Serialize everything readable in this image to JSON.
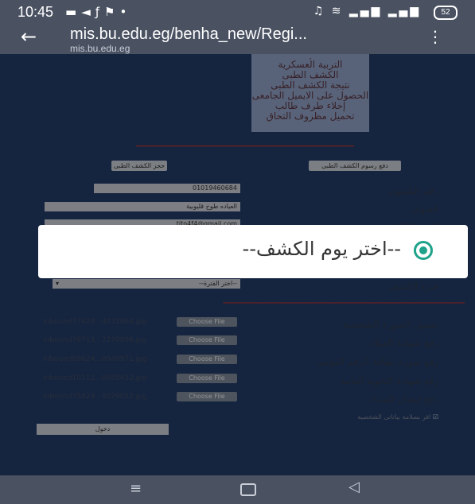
{
  "status_bar": {
    "time": "10:45",
    "left_icons": [
      "message-icon",
      "send-icon",
      "facebook-icon",
      "notification-icon",
      "dot-icon"
    ],
    "battery": "52"
  },
  "browser": {
    "url": "mis.bu.edu.eg/benha_new/Regi...",
    "domain": "mis.bu.edu.eg"
  },
  "menu_box": {
    "items": [
      "التربية العسكرية",
      "الكشف الطبى",
      "نتيجة الكشف الطبى",
      "الحصول على الايميل الجامعى",
      "إخلاء طرف طالب",
      "تحميل مظروف التحاق"
    ]
  },
  "buttons": {
    "pay_medical_fee": "دفع رسوم الكشف الطبى",
    "book_medical": "حجز الكشف الطبى",
    "choose_file": "Choose File",
    "submit": "دخول"
  },
  "form": {
    "phone_label": "رقم التليفون",
    "phone_value": "01019460684",
    "address_label": "العنوان",
    "address_value": "العياده طوخ قليوبية",
    "email_label": "البريد الالكترونى",
    "email_value": "tito4f4@gmail.com",
    "exam_period_label": "فترة الكشف",
    "exam_period_value": "--اختر الفترة--",
    "photo_label": "تحميل الصورة الشخصية",
    "birth_cert_label": "رفع شهادة الميلاد",
    "national_id_label": "رفع صورة بطاقة الرقم القومى",
    "secondary_cert_label": "رفع شهادة الثانوية العامة",
    "payment_label": "رفع إيصال السداد",
    "confirm_label": "اقر بسلامة بياناتى الشخصية",
    "files": [
      "inbound37429...4031464.jpg",
      "inbound76713...2270906.jpg",
      "inbound68624...0949971.jpg",
      "inbound10112...0085432.jpg",
      "inbound35829...9029052.jpg"
    ]
  },
  "dialog": {
    "option_text": "--اختر يوم الكشف--"
  },
  "colors": {
    "page_bg": "#233a66",
    "radio_accent": "#1ea38a",
    "warning_text": "#c0392b"
  }
}
